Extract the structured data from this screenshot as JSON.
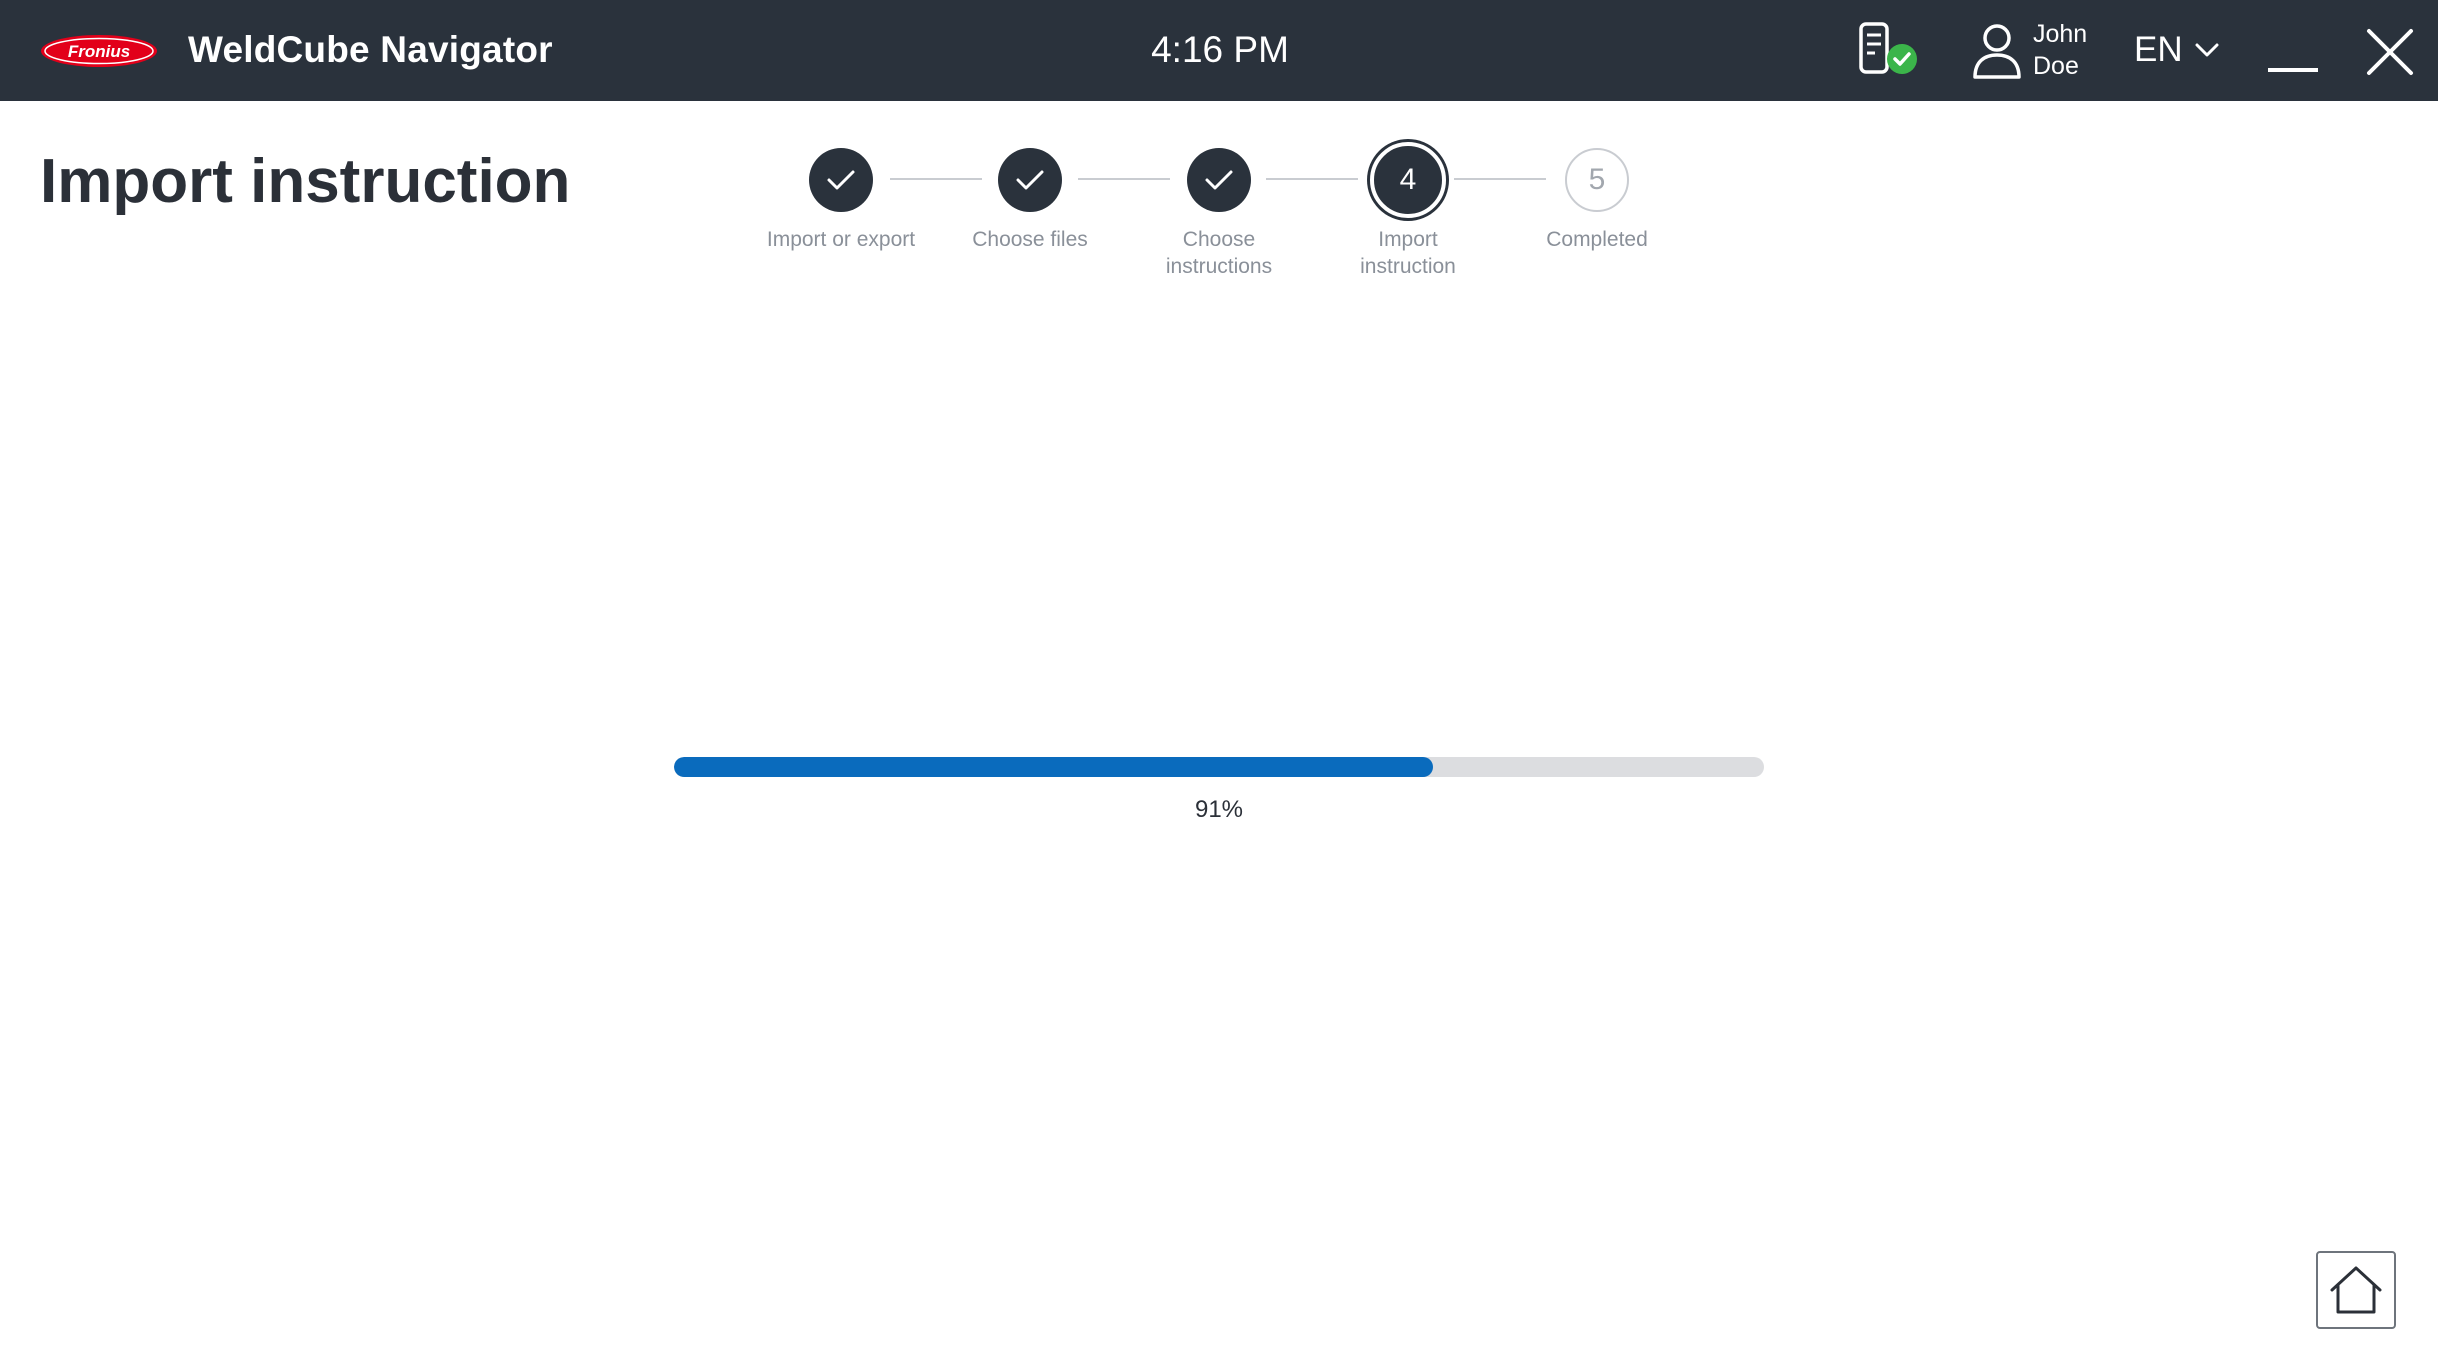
{
  "header": {
    "brand_logo_text": "Fronius",
    "app_title": "WeldCube Navigator",
    "time": "4:16 PM",
    "user": {
      "first_name": "John",
      "last_name": "Doe"
    },
    "language": "EN",
    "icons": {
      "device": "device-connected-icon",
      "user": "user-icon",
      "lang": "chevron-down-icon",
      "minimize": "minimize-icon",
      "close": "close-icon"
    }
  },
  "page": {
    "title": "Import instruction"
  },
  "stepper": {
    "steps": [
      {
        "label": "Import or export",
        "state": "done"
      },
      {
        "label": "Choose files",
        "state": "done"
      },
      {
        "label": "Choose instructions",
        "state": "done"
      },
      {
        "label": "Import instruction",
        "state": "current",
        "number": "4"
      },
      {
        "label": "Completed",
        "state": "todo",
        "number": "5"
      }
    ]
  },
  "progress": {
    "fill_fraction": 0.696,
    "label": "91%"
  },
  "footer": {
    "home_icon": "home-icon"
  },
  "colors": {
    "header_bg": "#2a323c",
    "accent_blue": "#0a6bbd",
    "success_green": "#3bb54a",
    "brand_red": "#e2001a"
  }
}
